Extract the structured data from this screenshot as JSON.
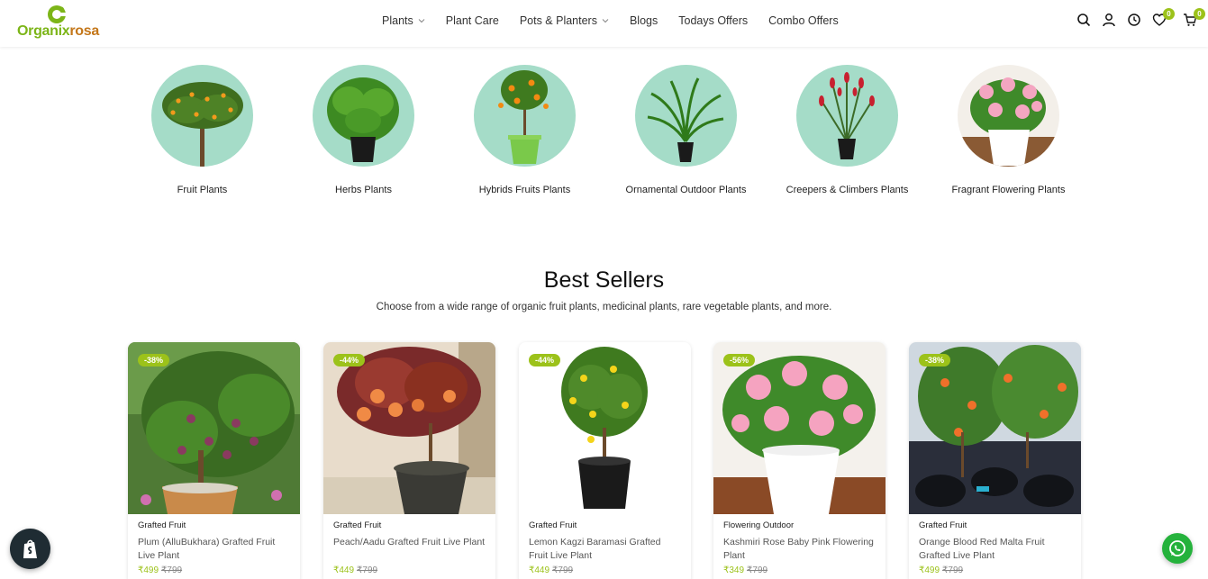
{
  "brand": {
    "name_part1": "Organix",
    "name_part2": "rosa",
    "colors": {
      "green": "#7cb518",
      "orange": "#c4771a",
      "accent": "#9cc21a"
    }
  },
  "nav": {
    "items": [
      {
        "label": "Plants",
        "has_dropdown": true
      },
      {
        "label": "Plant Care",
        "has_dropdown": false
      },
      {
        "label": "Pots & Planters",
        "has_dropdown": true
      },
      {
        "label": "Blogs",
        "has_dropdown": false
      },
      {
        "label": "Todays Offers",
        "has_dropdown": false
      },
      {
        "label": "Combo Offers",
        "has_dropdown": false
      }
    ]
  },
  "header_icons": {
    "search": "search-icon",
    "account": "user-icon",
    "recent": "clock-icon",
    "wishlist": {
      "icon": "heart-icon",
      "count": "0"
    },
    "cart": {
      "icon": "cart-icon",
      "count": "0"
    }
  },
  "categories": [
    {
      "label": "Fruit Plants"
    },
    {
      "label": "Herbs Plants"
    },
    {
      "label": "Hybrids Fruits Plants"
    },
    {
      "label": "Ornamental Outdoor Plants"
    },
    {
      "label": "Creepers & Climbers Plants"
    },
    {
      "label": "Fragrant Flowering Plants"
    }
  ],
  "best_sellers": {
    "title": "Best Sellers",
    "subtitle": "Choose from a wide range of organic fruit plants, medicinal plants, rare vegetable plants, and more.",
    "products": [
      {
        "discount": "-38%",
        "category": "Grafted Fruit",
        "name": "Plum (AlluBukhara) Grafted Fruit Live Plant",
        "price": "₹499",
        "compare_price": "₹799"
      },
      {
        "discount": "-44%",
        "category": "Grafted Fruit",
        "name": "Peach/Aadu Grafted Fruit Live Plant",
        "price": "₹449",
        "compare_price": "₹799"
      },
      {
        "discount": "-44%",
        "category": "Grafted Fruit",
        "name": "Lemon Kagzi Baramasi Grafted Fruit Live Plant",
        "price": "₹449",
        "compare_price": "₹799"
      },
      {
        "discount": "-56%",
        "category": "Flowering Outdoor",
        "name": "Kashmiri Rose Baby Pink Flowering Plant",
        "price": "₹349",
        "compare_price": "₹799"
      },
      {
        "discount": "-38%",
        "category": "Grafted Fruit",
        "name": "Orange Blood Red Malta Fruit Grafted Live Plant",
        "price": "₹499",
        "compare_price": "₹799"
      }
    ]
  },
  "floating": {
    "shopify": "shopify-icon",
    "whatsapp": "whatsapp-icon"
  }
}
